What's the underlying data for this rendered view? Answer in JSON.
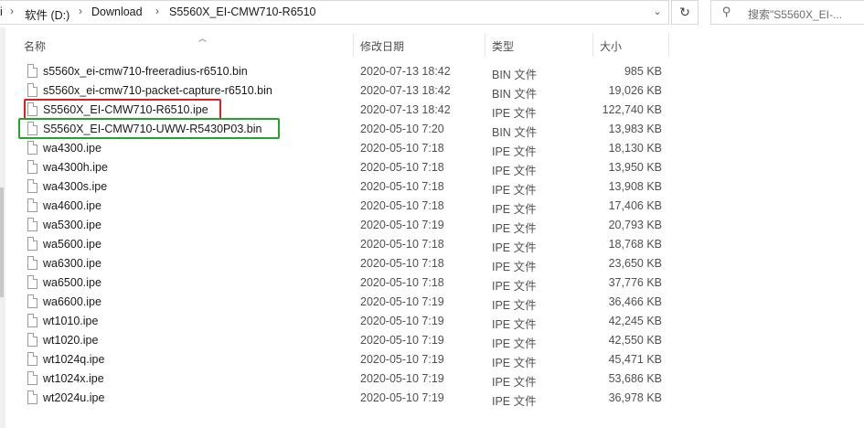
{
  "address_bar": {
    "partial_left": "i",
    "crumbs": [
      "软件 (D:)",
      "Download",
      "S5560X_EI-CMW710-R6510"
    ]
  },
  "search": {
    "placeholder": "搜索\"S5560X_EI-..."
  },
  "columns": {
    "name": "名称",
    "date": "修改日期",
    "type": "类型",
    "size": "大小"
  },
  "files": [
    {
      "name": "s5560x_ei-cmw710-freeradius-r6510.bin",
      "date": "2020-07-13 18:42",
      "type": "BIN 文件",
      "size": "985 KB"
    },
    {
      "name": "s5560x_ei-cmw710-packet-capture-r6510.bin",
      "date": "2020-07-13 18:42",
      "type": "BIN 文件",
      "size": "19,026 KB"
    },
    {
      "name": "S5560X_EI-CMW710-R6510.ipe",
      "date": "2020-07-13 18:42",
      "type": "IPE 文件",
      "size": "122,740 KB"
    },
    {
      "name": "S5560X_EI-CMW710-UWW-R5430P03.bin",
      "date": "2020-05-10 7:20",
      "type": "BIN 文件",
      "size": "13,983 KB"
    },
    {
      "name": "wa4300.ipe",
      "date": "2020-05-10 7:18",
      "type": "IPE 文件",
      "size": "18,130 KB"
    },
    {
      "name": "wa4300h.ipe",
      "date": "2020-05-10 7:18",
      "type": "IPE 文件",
      "size": "13,950 KB"
    },
    {
      "name": "wa4300s.ipe",
      "date": "2020-05-10 7:18",
      "type": "IPE 文件",
      "size": "13,908 KB"
    },
    {
      "name": "wa4600.ipe",
      "date": "2020-05-10 7:18",
      "type": "IPE 文件",
      "size": "17,406 KB"
    },
    {
      "name": "wa5300.ipe",
      "date": "2020-05-10 7:19",
      "type": "IPE 文件",
      "size": "20,793 KB"
    },
    {
      "name": "wa5600.ipe",
      "date": "2020-05-10 7:18",
      "type": "IPE 文件",
      "size": "18,768 KB"
    },
    {
      "name": "wa6300.ipe",
      "date": "2020-05-10 7:18",
      "type": "IPE 文件",
      "size": "23,650 KB"
    },
    {
      "name": "wa6500.ipe",
      "date": "2020-05-10 7:18",
      "type": "IPE 文件",
      "size": "37,776 KB"
    },
    {
      "name": "wa6600.ipe",
      "date": "2020-05-10 7:19",
      "type": "IPE 文件",
      "size": "36,466 KB"
    },
    {
      "name": "wt1010.ipe",
      "date": "2020-05-10 7:19",
      "type": "IPE 文件",
      "size": "42,245 KB"
    },
    {
      "name": "wt1020.ipe",
      "date": "2020-05-10 7:19",
      "type": "IPE 文件",
      "size": "42,550 KB"
    },
    {
      "name": "wt1024q.ipe",
      "date": "2020-05-10 7:19",
      "type": "IPE 文件",
      "size": "45,471 KB"
    },
    {
      "name": "wt1024x.ipe",
      "date": "2020-05-10 7:19",
      "type": "IPE 文件",
      "size": "53,686 KB"
    },
    {
      "name": "wt2024u.ipe",
      "date": "2020-05-10 7:19",
      "type": "IPE 文件",
      "size": "36,978 KB"
    }
  ],
  "highlights": [
    {
      "row": 2,
      "color": "#e02020"
    },
    {
      "row": 3,
      "color": "#22a52a"
    }
  ],
  "icons": {
    "breadcrumb_separator": "chevron-right-icon",
    "dropdown": "chevron-down-icon",
    "refresh": "refresh-icon",
    "search": "search-icon",
    "file": "file-icon",
    "sort": "sort-ascending-icon"
  }
}
